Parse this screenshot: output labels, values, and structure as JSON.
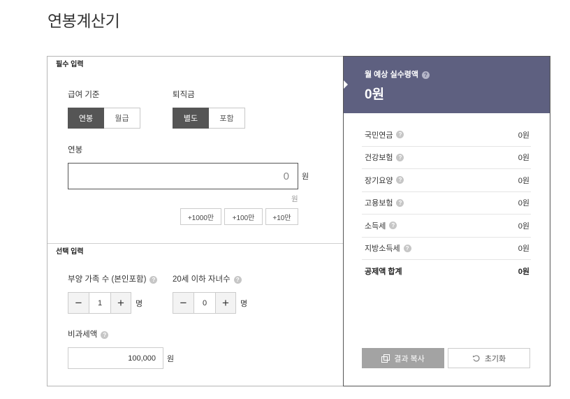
{
  "page": {
    "title": "연봉계산기"
  },
  "colors": {
    "header_bg": "#5e6080",
    "selected_toggle": "#555555",
    "copy_button_bg": "#a3a3a3"
  },
  "icons": {
    "help_glyph": "?",
    "help": "help-icon",
    "copy": "copy-icon",
    "reset": "reset-icon"
  },
  "stepper": {
    "minus": "−",
    "plus": "+"
  },
  "required": {
    "section_title": "필수 입력",
    "salary_basis": {
      "label": "급여 기준",
      "options": [
        "연봉",
        "월급"
      ],
      "selected": "연봉"
    },
    "severance": {
      "label": "퇴직금",
      "options": [
        "별도",
        "포함"
      ],
      "selected": "별도"
    },
    "annual_salary": {
      "label": "연봉",
      "value": "0",
      "unit": "원",
      "amount_in_words": "원"
    },
    "quick_add": [
      "+1000만",
      "+100만",
      "+10만"
    ]
  },
  "optional": {
    "section_title": "선택 입력",
    "dependents": {
      "label": "부양 가족 수 (본인포함)",
      "value": "1",
      "unit": "명"
    },
    "children_under_20": {
      "label": "20세 이하 자녀수",
      "value": "0",
      "unit": "명"
    },
    "non_taxable": {
      "label": "비과세액",
      "value": "100,000",
      "unit": "원"
    }
  },
  "result": {
    "net_label": "월 예상 실수령액",
    "net_value": "0원",
    "deductions": [
      {
        "label": "국민연금",
        "value": "0원"
      },
      {
        "label": "건강보험",
        "value": "0원"
      },
      {
        "label": "장기요양",
        "value": "0원"
      },
      {
        "label": "고용보험",
        "value": "0원"
      },
      {
        "label": "소득세",
        "value": "0원"
      },
      {
        "label": "지방소득세",
        "value": "0원"
      }
    ],
    "total": {
      "label": "공제액 합계",
      "value": "0원"
    },
    "copy_button": "결과 복사",
    "reset_button": "초기화"
  }
}
